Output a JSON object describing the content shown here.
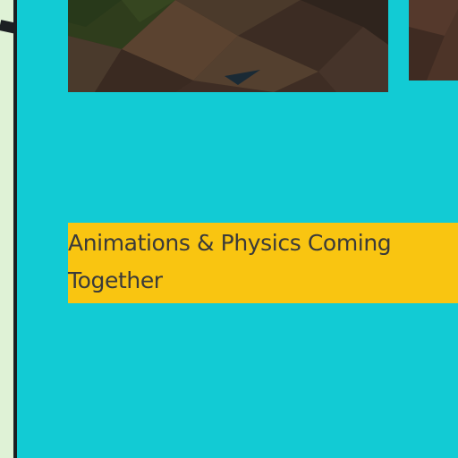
{
  "post": {
    "title": "Animations & Physics Coming Together"
  },
  "colors": {
    "card_bg": "#12cbd4",
    "title_highlight": "#f9c511",
    "page_bg": "#dff2d6",
    "rule": "#1b1f22"
  },
  "images": {
    "main": "terrain-thumbnail",
    "side": "terrain-thumbnail-2"
  }
}
